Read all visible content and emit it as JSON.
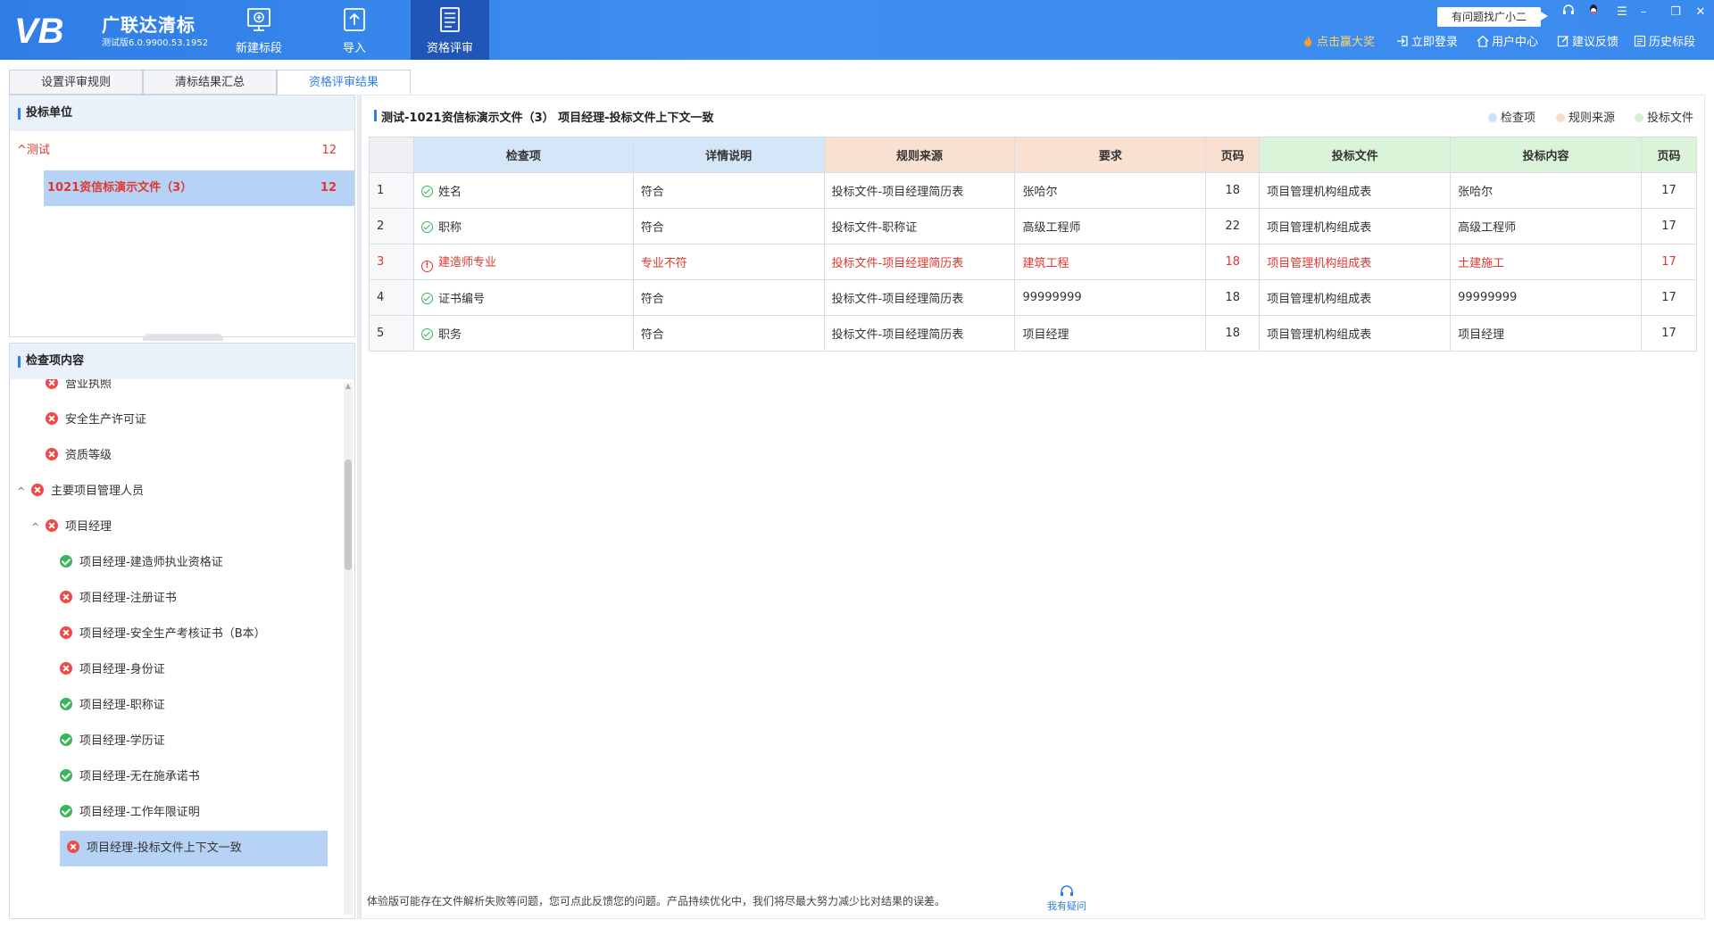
{
  "app": {
    "logo_text": "VB",
    "name": "广联达清标",
    "version": "测试版6.0.9900.53.1952"
  },
  "toolbar": {
    "items": [
      {
        "label": "新建标段",
        "icon": "new-section-icon"
      },
      {
        "label": "导入",
        "icon": "import-icon"
      },
      {
        "label": "资格评审",
        "icon": "qualification-review-icon"
      }
    ]
  },
  "header": {
    "help_bubble": "有问题找广小二",
    "links": [
      {
        "label": "点击赢大奖",
        "icon": "flame-icon"
      },
      {
        "label": "立即登录",
        "icon": "login-icon"
      },
      {
        "label": "用户中心",
        "icon": "home-icon"
      },
      {
        "label": "建议反馈",
        "icon": "edit-icon"
      },
      {
        "label": "历史标段",
        "icon": "history-icon"
      }
    ],
    "colors": {
      "brand": "#3b8aee",
      "active_tool": "#1f56b8",
      "award": "#ffd66b"
    }
  },
  "tabs": [
    {
      "label": "设置评审规则"
    },
    {
      "label": "清标结果汇总"
    },
    {
      "label": "资格评审结果"
    }
  ],
  "bidders": {
    "title": "投标单位",
    "group": {
      "name": "测试",
      "count": "12"
    },
    "item": {
      "name": "1021资信标演示文件（3）",
      "count": "12"
    }
  },
  "check_items": {
    "title": "检查项内容",
    "items": [
      {
        "label": "营业执照",
        "status": "bad"
      },
      {
        "label": "安全生产许可证",
        "status": "bad"
      },
      {
        "label": "资质等级",
        "status": "bad"
      },
      {
        "label": "主要项目管理人员",
        "status": "bad"
      },
      {
        "label": "项目经理",
        "status": "bad"
      },
      {
        "label": "项目经理-建造师执业资格证",
        "status": "ok"
      },
      {
        "label": "项目经理-注册证书",
        "status": "bad"
      },
      {
        "label": "项目经理-安全生产考核证书（B本）",
        "status": "bad"
      },
      {
        "label": "项目经理-身份证",
        "status": "bad"
      },
      {
        "label": "项目经理-职称证",
        "status": "ok"
      },
      {
        "label": "项目经理-学历证",
        "status": "ok"
      },
      {
        "label": "项目经理-无在施承诺书",
        "status": "ok"
      },
      {
        "label": "项目经理-工作年限证明",
        "status": "ok"
      },
      {
        "label": "项目经理-投标文件上下文一致",
        "status": "bad"
      }
    ]
  },
  "detail": {
    "title": "测试-1021资信标演示文件（3） 项目经理-投标文件上下文一致",
    "legend": [
      {
        "label": "检查项",
        "color": "#cfe2f7"
      },
      {
        "label": "规则来源",
        "color": "#f8dcc8"
      },
      {
        "label": "投标文件",
        "color": "#d6f0d2"
      }
    ],
    "columns": [
      "检查项",
      "详情说明",
      "规则来源",
      "要求",
      "页码",
      "投标文件",
      "投标内容",
      "页码"
    ],
    "rows": [
      {
        "idx": "1",
        "item": "姓名",
        "desc": "符合",
        "rule": "投标文件-项目经理简历表",
        "req": "张哈尔",
        "page": "18",
        "bid_file": "项目管理机构组成表",
        "bid_content": "张哈尔",
        "bid_page": "17",
        "status": "ok"
      },
      {
        "idx": "2",
        "item": "职称",
        "desc": "符合",
        "rule": "投标文件-职称证",
        "req": "高级工程师",
        "page": "22",
        "bid_file": "项目管理机构组成表",
        "bid_content": "高级工程师",
        "bid_page": "17",
        "status": "ok"
      },
      {
        "idx": "3",
        "item": "建造师专业",
        "desc": "专业不符",
        "rule": "投标文件-项目经理简历表",
        "req": "建筑工程",
        "page": "18",
        "bid_file": "项目管理机构组成表",
        "bid_content": "土建施工",
        "bid_page": "17",
        "status": "error"
      },
      {
        "idx": "4",
        "item": "证书编号",
        "desc": "符合",
        "rule": "投标文件-项目经理简历表",
        "req": "99999999",
        "page": "18",
        "bid_file": "项目管理机构组成表",
        "bid_content": "99999999",
        "bid_page": "17",
        "status": "ok"
      },
      {
        "idx": "5",
        "item": "职务",
        "desc": "符合",
        "rule": "投标文件-项目经理简历表",
        "req": "项目经理",
        "page": "18",
        "bid_file": "项目管理机构组成表",
        "bid_content": "项目经理",
        "bid_page": "17",
        "status": "ok"
      }
    ],
    "footer_note": "体验版可能存在文件解析失败等问题，您可点此反馈您的问题。产品持续优化中，我们将尽最大努力减少比对结果的误差。",
    "ask_label": "我有疑问"
  }
}
